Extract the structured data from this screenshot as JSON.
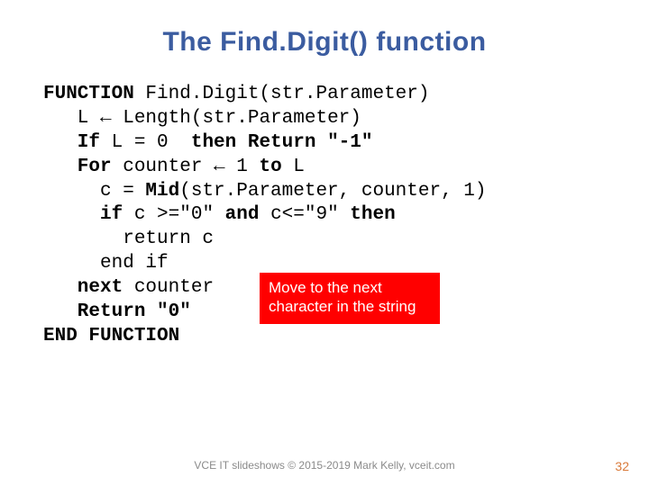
{
  "title": "The Find.Digit() function",
  "code": {
    "l1a": "FUNCTION",
    "l1b": " Find.Digit(str.Parameter)",
    "l2a": "   L ",
    "l2arrow": "←",
    "l2b": " Length(str.Parameter)",
    "l3a": "   If ",
    "l3b": "L = 0  ",
    "l3c": "then Return \"-1\"",
    "l4a": "   For ",
    "l4b": "counter ",
    "l4arrow": "←",
    "l4c": " 1 ",
    "l4d": "to",
    "l4e": " L",
    "l5a": "     c = ",
    "l5b": "Mid",
    "l5c": "(str.Parameter, counter, 1)",
    "l6a": "     if ",
    "l6b": "c >=\"0\" ",
    "l6c": "and",
    "l6d": " c<=\"9\" ",
    "l6e": "then",
    "l7": "       return c",
    "l8": "     end if",
    "l9a": "   next ",
    "l9b": "counter",
    "l10": "   Return \"0\"",
    "l11": "END FUNCTION"
  },
  "callout": "Move to the next character in the string",
  "footer": "VCE IT slideshows © 2015-2019 Mark Kelly, vceit.com",
  "page_number": "32"
}
